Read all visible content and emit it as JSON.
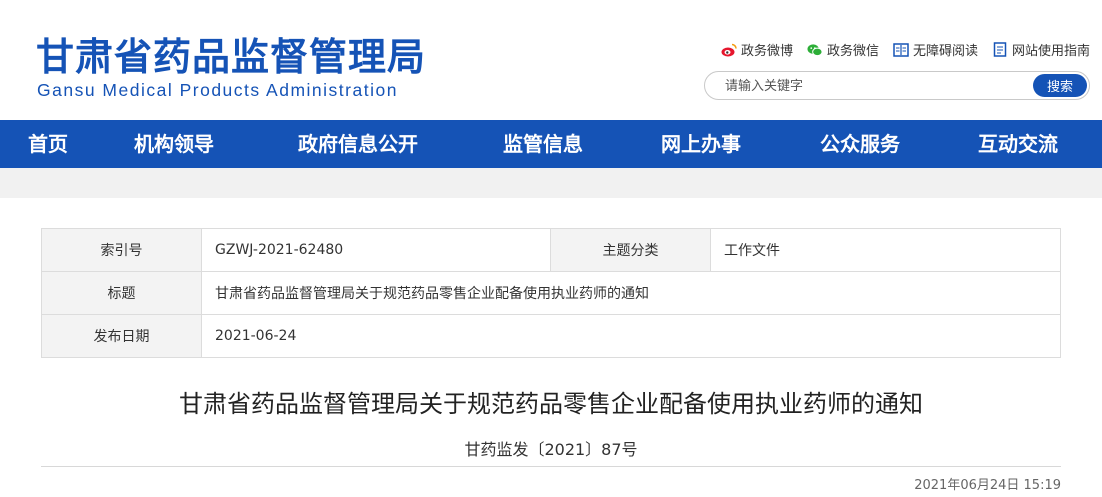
{
  "header": {
    "logo_cn": "甘肃省药品监督管理局",
    "logo_en": "Gansu Medical Products Administration",
    "links": [
      {
        "label": "政务微博",
        "icon": "weibo-icon"
      },
      {
        "label": "政务微信",
        "icon": "wechat-icon"
      },
      {
        "label": "无障碍阅读",
        "icon": "accessibility-icon"
      },
      {
        "label": "网站使用指南",
        "icon": "guide-icon"
      }
    ],
    "search": {
      "placeholder": "请输入关键字",
      "button": "搜索"
    }
  },
  "nav": {
    "items": [
      "首页",
      "机构领导",
      "政府信息公开",
      "监管信息",
      "网上办事",
      "公众服务",
      "互动交流"
    ]
  },
  "info": {
    "index_label": "索引号",
    "index_value": "GZWJ-2021-62480",
    "category_label": "主题分类",
    "category_value": "工作文件",
    "title_label": "标题",
    "title_value": "甘肃省药品监督管理局关于规范药品零售企业配备使用执业药师的通知",
    "date_label": "发布日期",
    "date_value": "2021-06-24"
  },
  "article": {
    "title": "甘肃省药品监督管理局关于规范药品零售企业配备使用执业药师的通知",
    "doc_number": "甘药监发〔2021〕87号",
    "published": "2021年06月24日 15:19"
  },
  "colors": {
    "brand": "#1553b6",
    "table_label_bg": "#f3f3f3"
  }
}
